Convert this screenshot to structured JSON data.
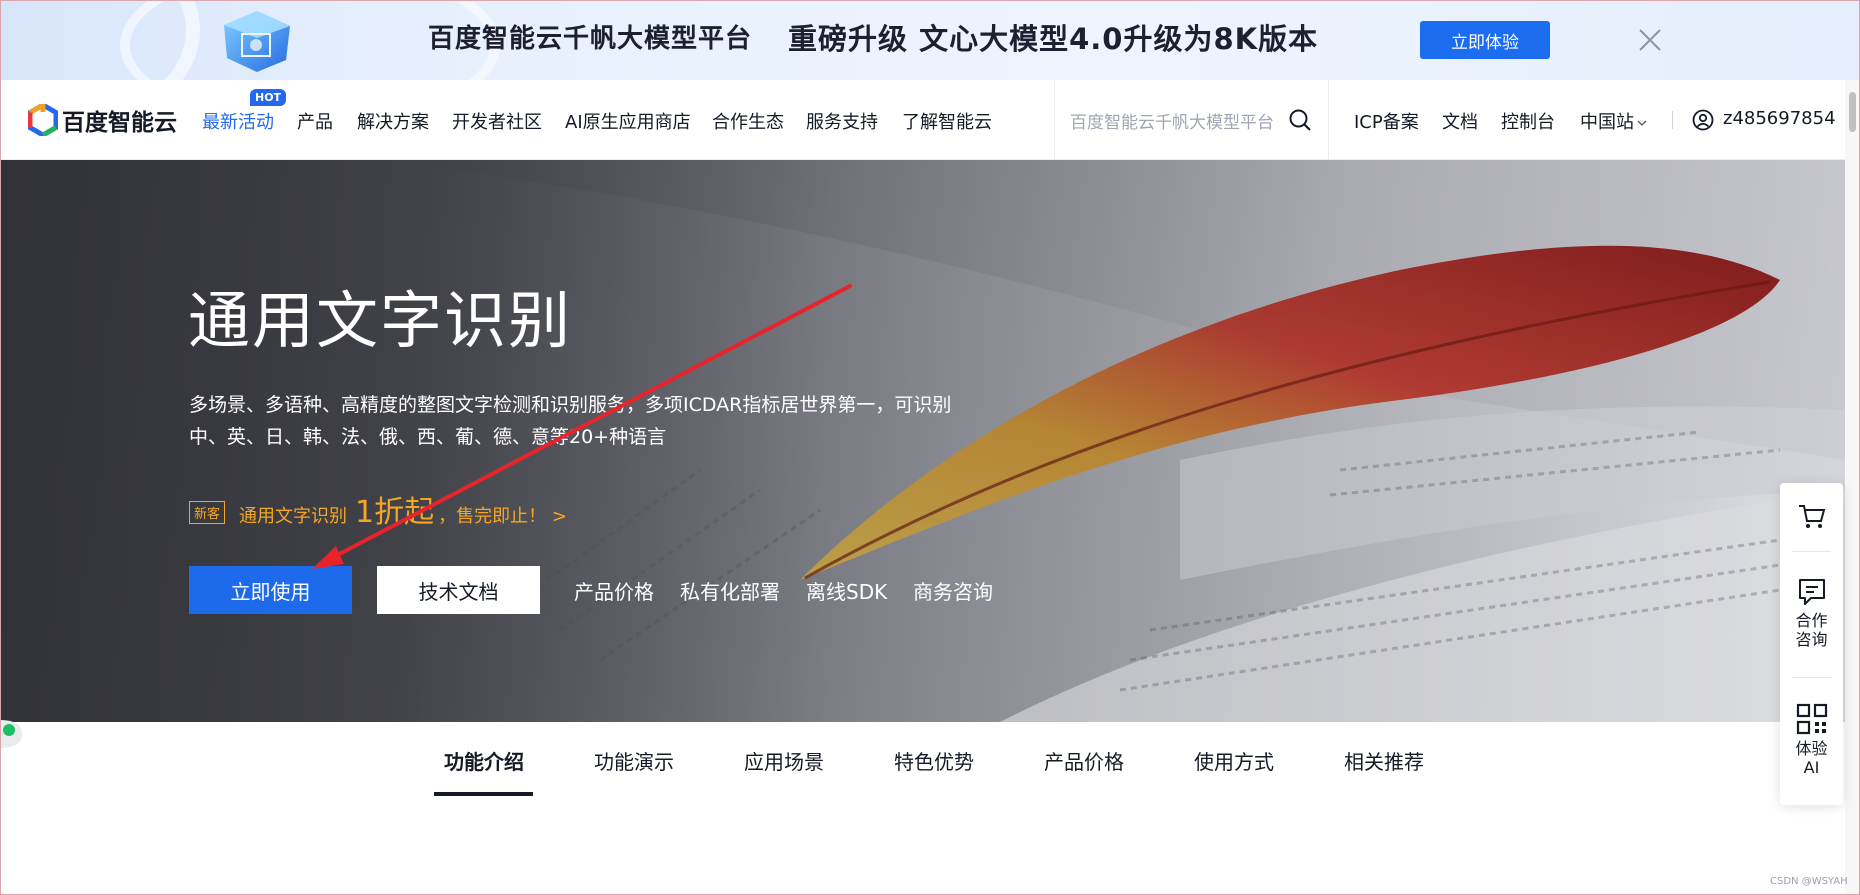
{
  "promo_banner": {
    "title": "百度智能云千帆大模型平台",
    "subtitle": "重磅升级 文心大模型4.0升级为8K版本",
    "cta_label": "立即体验"
  },
  "nav": {
    "logo_text": "百度智能云",
    "hot_badge": "HOT",
    "items": [
      "最新活动",
      "产品",
      "解决方案",
      "开发者社区",
      "AI原生应用商店",
      "合作生态",
      "服务支持",
      "了解智能云"
    ],
    "search_placeholder": "百度智能云千帆大模型平台",
    "right_links": [
      "ICP备案",
      "文档",
      "控制台",
      "中国站"
    ],
    "username": "z485697854"
  },
  "hero": {
    "title": "通用文字识别",
    "description": "多场景、多语种、高精度的整图文字检测和识别服务，多项ICDAR指标居世界第一，可识别中、英、日、韩、法、俄、西、葡、德、意等20+种语言",
    "new_badge": "新客",
    "promo_text": "通用文字识别",
    "promo_big": "1折起",
    "promo_tail": "，售完即止！ >",
    "primary_button": "立即使用",
    "secondary_button": "技术文档",
    "links": [
      "产品价格",
      "私有化部署",
      "离线SDK",
      "商务咨询"
    ]
  },
  "side_panel": {
    "consult_line1": "合作",
    "consult_line2": "咨询",
    "ai_line1": "体验",
    "ai_line2": "AI"
  },
  "tabs": [
    "功能介绍",
    "功能演示",
    "应用场景",
    "特色优势",
    "产品价格",
    "使用方式",
    "相关推荐"
  ],
  "watermark": "CSDN @WSYAH",
  "colors": {
    "brand_blue": "#2468f2",
    "button_blue": "#1d6bea",
    "promo_orange": "#f5a623",
    "annotation_red": "#e8232b"
  }
}
